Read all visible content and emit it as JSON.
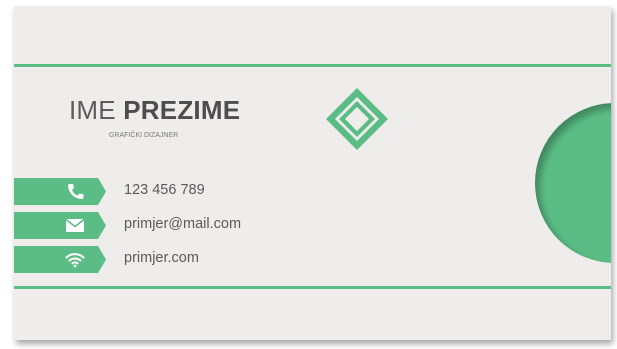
{
  "card": {
    "first_name": "IME",
    "last_name": "PREZIME",
    "job_title": "GRAFIČKI DIZAJNER"
  },
  "contacts": [
    {
      "icon": "phone-icon",
      "text": "123 456 789"
    },
    {
      "icon": "mail-icon",
      "text": "primjer@mail.com"
    },
    {
      "icon": "wifi-icon",
      "text": "primjer.com"
    }
  ],
  "colors": {
    "accent": "#5bbd85",
    "background": "#eeedeb",
    "text": "#5a5a5a"
  }
}
